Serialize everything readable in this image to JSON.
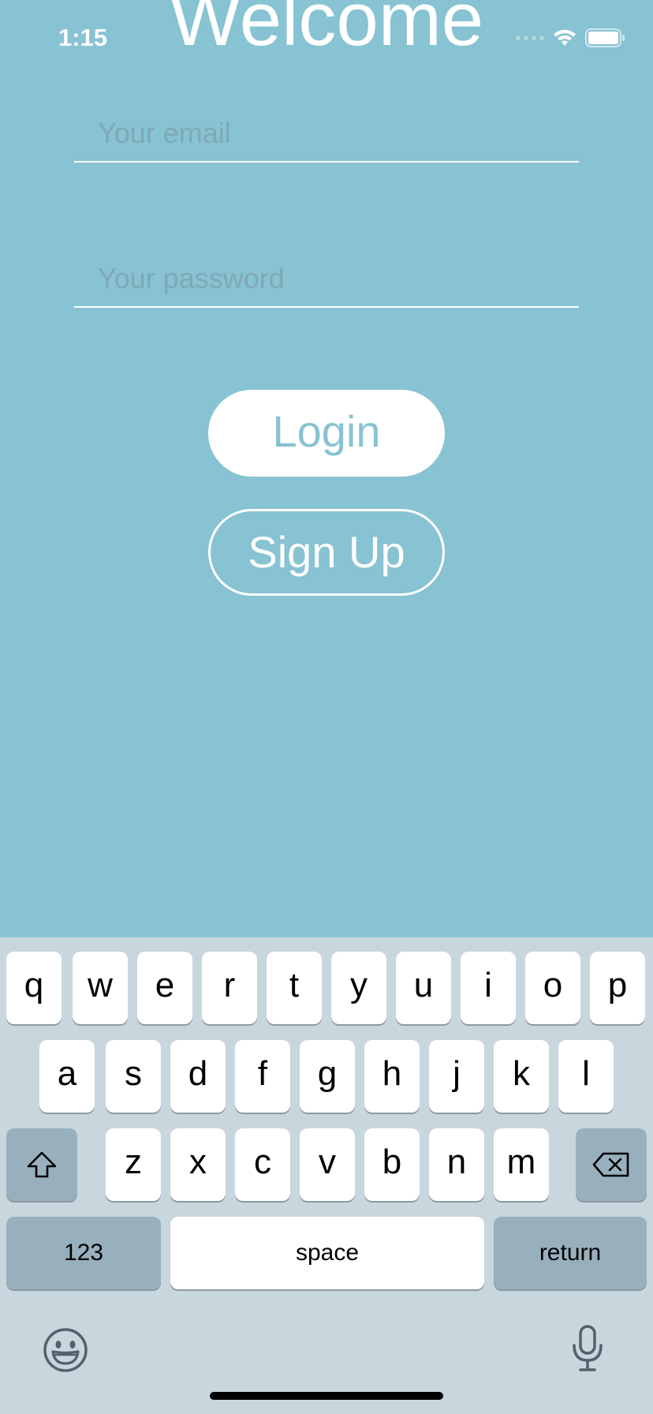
{
  "status_bar": {
    "time": "1:15"
  },
  "title": "Welcome",
  "email": {
    "placeholder": "Your email",
    "value": ""
  },
  "password": {
    "placeholder": "Your password",
    "value": ""
  },
  "buttons": {
    "login": "Login",
    "signup": "Sign Up"
  },
  "keyboard": {
    "row1": [
      "q",
      "w",
      "e",
      "r",
      "t",
      "y",
      "u",
      "i",
      "o",
      "p"
    ],
    "row2": [
      "a",
      "s",
      "d",
      "f",
      "g",
      "h",
      "j",
      "k",
      "l"
    ],
    "row3": [
      "z",
      "x",
      "c",
      "v",
      "b",
      "n",
      "m"
    ],
    "numbers_label": "123",
    "space_label": "space",
    "return_label": "return",
    "icons": {
      "shift": "shift-icon",
      "delete": "backspace-icon",
      "emoji": "emoji-icon",
      "mic": "microphone-icon"
    }
  },
  "colors": {
    "background": "#87c3d2",
    "keyboard_bg": "#c8d6dd",
    "dark_key": "#98b0bd"
  }
}
